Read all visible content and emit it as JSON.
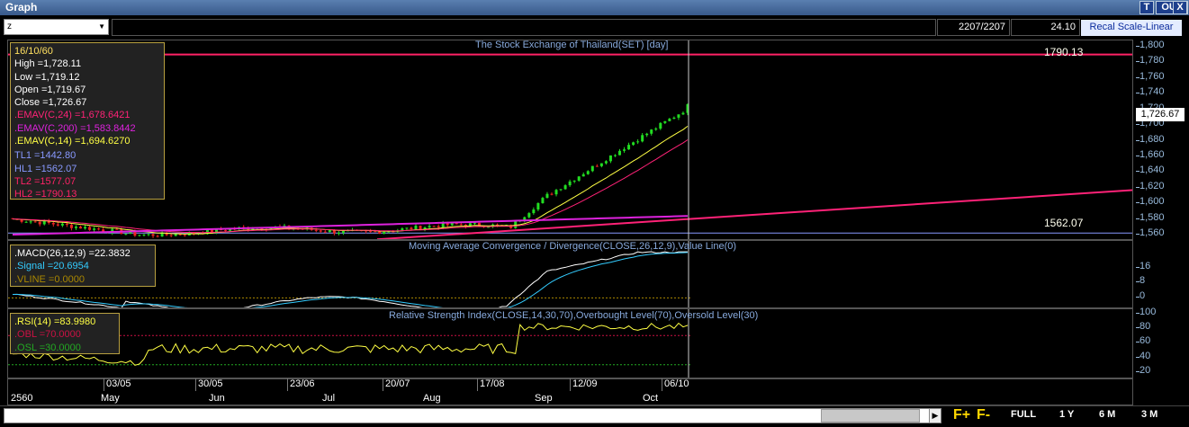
{
  "window": {
    "title": "Graph",
    "btn_t": "T",
    "btn_out": "OUT",
    "btn_close": "X"
  },
  "toolbar": {
    "symbol": "z",
    "count": "2207/2207",
    "zoom": "24.10",
    "recal": "Recal Scale-Linear"
  },
  "price_panel": {
    "title": "The Stock Exchange of Thailand(SET) [day]",
    "legend": {
      "date": "16/10/60",
      "high": "High  =1,728.11",
      "low": "Low  =1,719.12",
      "open": "Open  =1,719.67",
      "close": "Close  =1,726.67",
      "emav24": ".EMAV(C,24)   =1,678.6421",
      "emav200": ".EMAV(C,200)  =1,583.8442",
      "emav14": ".EMAV(C,14)   =1,694.6270",
      "tl1": "TL1 =1442.80",
      "hl1": "HL1 =1562.07",
      "tl2": "TL2 =1577.07",
      "hl2": "HL2 =1790.13"
    },
    "hl2_label": "1790.13",
    "hl1_label": "1562.07",
    "last_price": "1,726.67",
    "axis": [
      "1,800",
      "1,780",
      "1,760",
      "1,740",
      "1,720",
      "1,700",
      "1,680",
      "1,660",
      "1,640",
      "1,620",
      "1,600",
      "1,580",
      "1,560"
    ]
  },
  "macd_panel": {
    "title": "Moving Average Convergence / Divergence(CLOSE,26,12,9),Value Line(0)",
    "legend": {
      "macd": ".MACD(26,12,9)   =22.3832",
      "signal": ".Signal   =20.6954",
      "vline": ".VLINE   =0.0000"
    },
    "axis": [
      "16",
      "8",
      "0"
    ]
  },
  "rsi_panel": {
    "title": "Relative Strength Index(CLOSE,14,30,70),Overbought Level(70),Oversold Level(30)",
    "legend": {
      "rsi": ".RSI(14)   =83.9980",
      "obl": ".OBL   =70.0000",
      "osl": ".OSL   =30.0000"
    },
    "axis": [
      "100",
      "80",
      "60",
      "40",
      "20"
    ]
  },
  "dates": {
    "days": [
      "03/05",
      "30/05",
      "23/06",
      "20/07",
      "17/08",
      "12/09",
      "06/10"
    ],
    "months": [
      "2560",
      "May",
      "Jun",
      "Jul",
      "Aug",
      "Sep",
      "Oct"
    ]
  },
  "bottom": {
    "f_plus": "F+",
    "f_minus": "F-",
    "full": "FULL",
    "y1": "1 Y",
    "m6": "6 M",
    "m3": "3 M"
  },
  "colors": {
    "up": "#22dd22",
    "down": "#ee2222",
    "emav24": "#ff2277",
    "emav200": "#dd22dd",
    "emav14": "#ffff44",
    "hl2": "#ff2266",
    "hl1": "#8899ff",
    "tl2": "#ff2277"
  }
}
